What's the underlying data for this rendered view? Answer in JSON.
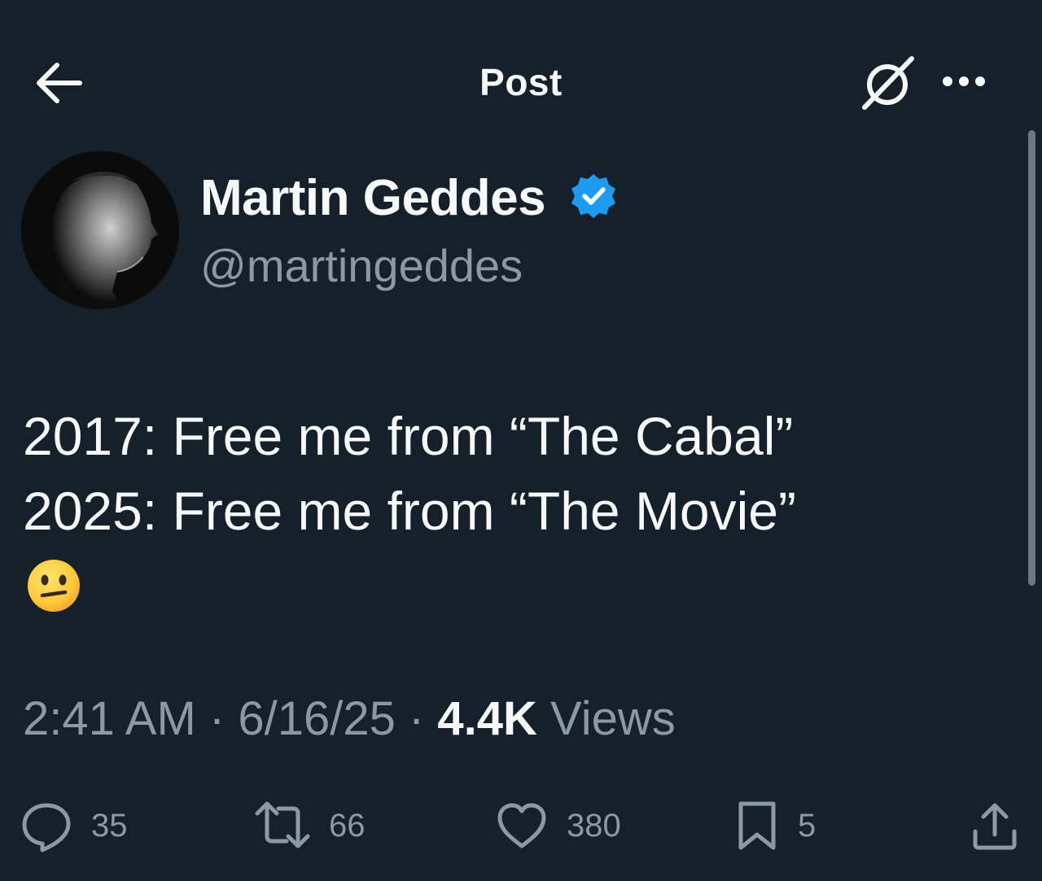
{
  "header": {
    "title": "Post",
    "back_icon": "arrow-left-icon",
    "grok_icon": "grok-icon",
    "more_icon": "more-dots-icon"
  },
  "author": {
    "display_name": "Martin Geddes",
    "handle": "@martingeddes",
    "verified": true,
    "verified_color": "#1d9bf0"
  },
  "tweet": {
    "lines": [
      "2017: Free me from “The Cabal”",
      "2025: Free me from “The Movie”"
    ],
    "emoji": "neutral-face-emoji"
  },
  "meta": {
    "time": "2:41 AM",
    "sep1": " · ",
    "date": "6/16/25",
    "sep2": " · ",
    "views_count": "4.4K",
    "views_label": " Views"
  },
  "actions": {
    "reply": "35",
    "repost": "66",
    "like": "380",
    "bookmark": "5"
  },
  "colors": {
    "background": "#15202b",
    "text_primary": "#f7f9f9",
    "text_secondary": "#8b98a5",
    "accent": "#1d9bf0"
  }
}
